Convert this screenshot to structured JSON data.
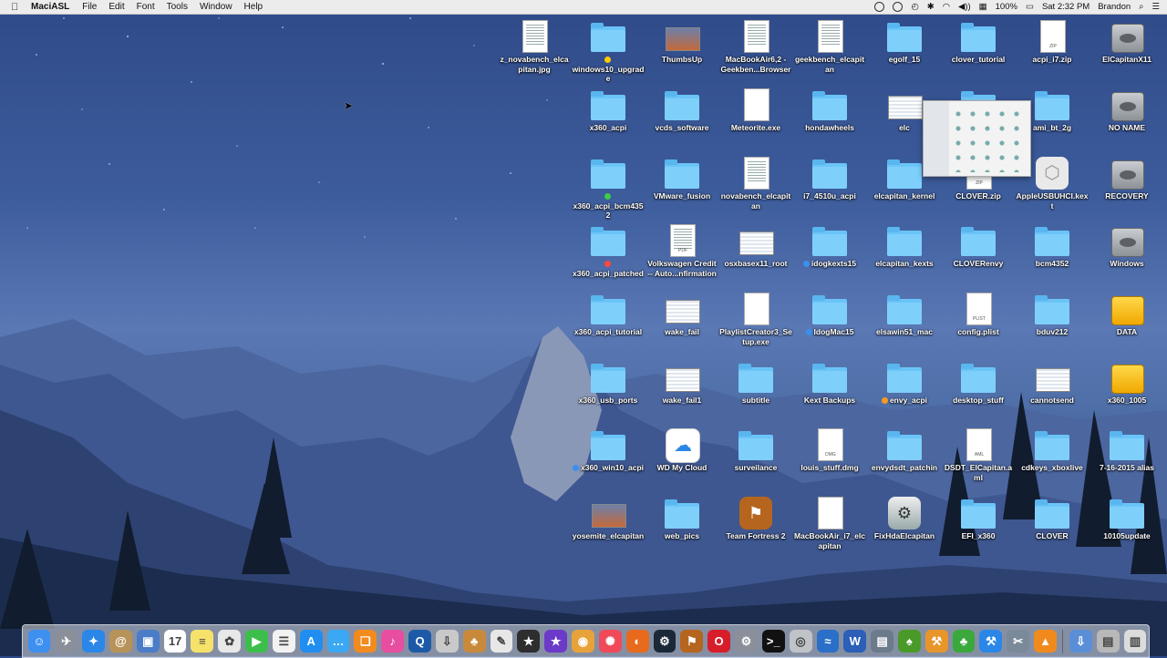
{
  "menubar": {
    "apple": "",
    "app_name": "MaciASL",
    "menus": [
      "File",
      "Edit",
      "Font",
      "Tools",
      "Window",
      "Help"
    ],
    "battery": "100%",
    "clock": "Sat 2:32 PM",
    "user": "Brandon"
  },
  "desktop": {
    "columns": [
      [
        {
          "label": "z_novabench_elcapitan.jpg",
          "kind": "doc"
        },
        {
          "label": "",
          "kind": "none"
        }
      ],
      [
        {
          "label": "windows10_upgrade",
          "kind": "folder",
          "tag": "#ffcc00"
        },
        {
          "label": "x360_acpi",
          "kind": "folder"
        },
        {
          "label": "x360_acpi_bcm4352",
          "kind": "folder",
          "tag": "#3ccd4a"
        },
        {
          "label": "x360_acpi_patched",
          "kind": "folder",
          "tag": "#ff4a3a"
        },
        {
          "label": "x360_acpi_tutorial",
          "kind": "folder"
        },
        {
          "label": "x360_usb_ports",
          "kind": "folder"
        },
        {
          "label": "x360_win10_acpi",
          "kind": "folder",
          "tag": "#3b8ff0"
        },
        {
          "label": "yosemite_elcapitan",
          "kind": "thumb-img"
        }
      ],
      [
        {
          "label": "ThumbsUp",
          "kind": "thumb-img"
        },
        {
          "label": "vcds_software",
          "kind": "folder"
        },
        {
          "label": "VMware_fusion",
          "kind": "folder"
        },
        {
          "label": "Volkswagen Credit -- Auto...nfirmation",
          "kind": "pdf"
        },
        {
          "label": "wake_fail",
          "kind": "thumb-ui"
        },
        {
          "label": "wake_fail1",
          "kind": "thumb-ui"
        },
        {
          "label": "WD My Cloud",
          "kind": "wdcloud"
        },
        {
          "label": "web_pics",
          "kind": "folder"
        }
      ],
      [
        {
          "label": "MacBookAir6,2 - Geekben...Browser",
          "kind": "doc"
        },
        {
          "label": "Meteorite.exe",
          "kind": "blank"
        },
        {
          "label": "novabench_elcapitan",
          "kind": "doc"
        },
        {
          "label": "osxbasex11_root",
          "kind": "thumb-ui"
        },
        {
          "label": "PlaylistCreator3_Setup.exe",
          "kind": "blank"
        },
        {
          "label": "subtitle",
          "kind": "folder"
        },
        {
          "label": "surveilance",
          "kind": "folder"
        },
        {
          "label": "Team Fortress 2",
          "kind": "tf2"
        }
      ],
      [
        {
          "label": "geekbench_elcapitan",
          "kind": "doc"
        },
        {
          "label": "hondawheels",
          "kind": "folder"
        },
        {
          "label": "i7_4510u_acpi",
          "kind": "folder"
        },
        {
          "label": "idogkexts15",
          "kind": "folder",
          "tag": "#3b8ff0"
        },
        {
          "label": "IdogMac15",
          "kind": "folder",
          "tag": "#3b8ff0"
        },
        {
          "label": "Kext Backups",
          "kind": "folder"
        },
        {
          "label": "louis_stuff.dmg",
          "kind": "dmg"
        },
        {
          "label": "MacBookAir_i7_elcapitan",
          "kind": "blank"
        }
      ],
      [
        {
          "label": "egolf_15",
          "kind": "folder"
        },
        {
          "label": "elc",
          "kind": "thumb-ui"
        },
        {
          "label": "elcapitan_kernel",
          "kind": "folder"
        },
        {
          "label": "elcapitan_kexts",
          "kind": "folder"
        },
        {
          "label": "elsawin51_mac",
          "kind": "folder"
        },
        {
          "label": "envy_acpi",
          "kind": "folder",
          "tag": "#ff9a1a"
        },
        {
          "label": "envydsdt_patchin",
          "kind": "folder"
        },
        {
          "label": "FixHdaElcapitan",
          "kind": "fixhda"
        }
      ],
      [
        {
          "label": "clover_tutorial",
          "kind": "folder"
        },
        {
          "label": "",
          "kind": "folder"
        },
        {
          "label": "CLOVER.zip",
          "kind": "zip"
        },
        {
          "label": "CLOVERenvy",
          "kind": "folder"
        },
        {
          "label": "config.plist",
          "kind": "plist"
        },
        {
          "label": "desktop_stuff",
          "kind": "folder"
        },
        {
          "label": "DSDT_ElCapitan.aml",
          "kind": "aml"
        },
        {
          "label": "EFI_x360",
          "kind": "folder"
        }
      ],
      [
        {
          "label": "acpi_i7.zip",
          "kind": "zip"
        },
        {
          "label": "ami_bt_2g",
          "kind": "folder"
        },
        {
          "label": "AppleUSBUHCI.kext",
          "kind": "kext"
        },
        {
          "label": "bcm4352",
          "kind": "folder"
        },
        {
          "label": "bduv212",
          "kind": "folder"
        },
        {
          "label": "cannotsend",
          "kind": "thumb-ui"
        },
        {
          "label": "cdkeys_xboxlive",
          "kind": "folder"
        },
        {
          "label": "CLOVER",
          "kind": "folder"
        }
      ],
      [
        {
          "label": "ElCapitanX11",
          "kind": "drive"
        },
        {
          "label": "NO NAME",
          "kind": "drive"
        },
        {
          "label": "RECOVERY",
          "kind": "drive"
        },
        {
          "label": "Windows",
          "kind": "drive"
        },
        {
          "label": "DATA",
          "kind": "drive-yellow"
        },
        {
          "label": "x360_1005",
          "kind": "drive-yellow"
        },
        {
          "label": "7-16-2015 alias",
          "kind": "folder"
        },
        {
          "label": "10105update",
          "kind": "folder"
        }
      ]
    ]
  },
  "dock": {
    "apps": [
      {
        "name": "finder-icon",
        "color": "#3d8ff0",
        "glyph": "☺"
      },
      {
        "name": "launchpad-icon",
        "color": "#8a8f9a",
        "glyph": "✈"
      },
      {
        "name": "safari-icon",
        "color": "#2a87e8",
        "glyph": "✦"
      },
      {
        "name": "contacts-icon",
        "color": "#b7935a",
        "glyph": "@"
      },
      {
        "name": "preview-icon",
        "color": "#4a7cc8",
        "glyph": "▣"
      },
      {
        "name": "calendar-icon",
        "color": "#ffffff",
        "glyph": "17"
      },
      {
        "name": "notes-icon",
        "color": "#f6e26a",
        "glyph": "≡"
      },
      {
        "name": "photos-icon",
        "color": "#e8e8e8",
        "glyph": "✿"
      },
      {
        "name": "facetime-icon",
        "color": "#3cbf4a",
        "glyph": "▶"
      },
      {
        "name": "reminders-icon",
        "color": "#f2f2f2",
        "glyph": "☰"
      },
      {
        "name": "appstore-icon",
        "color": "#1f8ef0",
        "glyph": "A"
      },
      {
        "name": "messages-icon",
        "color": "#3aa8f2",
        "glyph": "…"
      },
      {
        "name": "ibooks-icon",
        "color": "#f38a1d",
        "glyph": "❏"
      },
      {
        "name": "itunes-icon",
        "color": "#e84ea0",
        "glyph": "♪"
      },
      {
        "name": "quicktime-icon",
        "color": "#1c5aa8",
        "glyph": "Q"
      },
      {
        "name": "archive-icon",
        "color": "#c9c9c9",
        "glyph": "⇩"
      },
      {
        "name": "instruments-icon",
        "color": "#c88a3a",
        "glyph": "♣"
      },
      {
        "name": "script-icon",
        "color": "#e7e7e7",
        "glyph": "✎"
      },
      {
        "name": "grapher-icon",
        "color": "#2e2e2e",
        "glyph": "★"
      },
      {
        "name": "imovie-icon",
        "color": "#6b3ac8",
        "glyph": "★"
      },
      {
        "name": "chrome-icon",
        "color": "#e8a23a",
        "glyph": "◉"
      },
      {
        "name": "pinwheel-icon",
        "color": "#f04a5a",
        "glyph": "✺"
      },
      {
        "name": "firefox-icon",
        "color": "#e86a1d",
        "glyph": "◐"
      },
      {
        "name": "steam-icon",
        "color": "#1b2838",
        "glyph": "⚙"
      },
      {
        "name": "tf2-icon",
        "color": "#b5651d",
        "glyph": "⚑"
      },
      {
        "name": "opera-icon",
        "color": "#d81d2a",
        "glyph": "O"
      },
      {
        "name": "sysprefs-icon",
        "color": "#8a8f9a",
        "glyph": "⚙"
      },
      {
        "name": "terminal-icon",
        "color": "#111111",
        "glyph": ">_"
      },
      {
        "name": "diskutility-icon",
        "color": "#c0c4c8",
        "glyph": "◎"
      },
      {
        "name": "activity-icon",
        "color": "#2a6fc8",
        "glyph": "≈"
      },
      {
        "name": "word-icon",
        "color": "#2b5fb8",
        "glyph": "W"
      },
      {
        "name": "printer-icon",
        "color": "#6b7b8b",
        "glyph": "▤"
      },
      {
        "name": "kextwizard-icon",
        "color": "#4a9a2a",
        "glyph": "♠"
      },
      {
        "name": "wand-icon",
        "color": "#e8952a",
        "glyph": "⚒"
      },
      {
        "name": "leaf-icon",
        "color": "#3aa83a",
        "glyph": "♣"
      },
      {
        "name": "xcode-icon",
        "color": "#2a87e8",
        "glyph": "⚒"
      },
      {
        "name": "utilities-icon",
        "color": "#7a8a9a",
        "glyph": "✂"
      },
      {
        "name": "vlc-icon",
        "color": "#f08a1d",
        "glyph": "▲"
      }
    ],
    "trailing": [
      {
        "name": "downloads-icon",
        "color": "#5a8fd8",
        "glyph": "⇩"
      },
      {
        "name": "documents-icon",
        "color": "#b8b8b8",
        "glyph": "▤"
      },
      {
        "name": "trash-icon",
        "color": "#dcdcdc",
        "glyph": "▥"
      }
    ]
  }
}
